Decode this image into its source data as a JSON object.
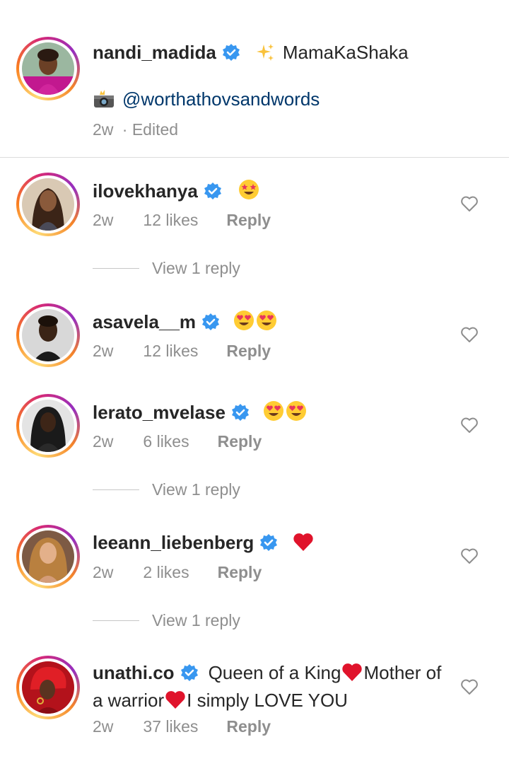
{
  "caption": {
    "username": "nandi_madida",
    "text": "MamaKaShaka",
    "mention": "@worthathovsandwords",
    "time": "2w",
    "edited": "· Edited"
  },
  "comments": [
    {
      "username": "ilovekhanya",
      "text": "",
      "emoji": [
        "star-struck"
      ],
      "time": "2w",
      "likes": "12 likes",
      "reply": "Reply",
      "view_replies": "View 1 reply"
    },
    {
      "username": "asavela__m",
      "text": "",
      "emoji": [
        "heart-eyes",
        "heart-eyes"
      ],
      "time": "2w",
      "likes": "12 likes",
      "reply": "Reply",
      "view_replies": ""
    },
    {
      "username": "lerato_mvelase",
      "text": "",
      "emoji": [
        "heart-eyes",
        "heart-eyes"
      ],
      "time": "2w",
      "likes": "6 likes",
      "reply": "Reply",
      "view_replies": "View 1 reply"
    },
    {
      "username": "leeann_liebenberg",
      "text": "",
      "emoji": [
        "red-heart"
      ],
      "time": "2w",
      "likes": "2 likes",
      "reply": "Reply",
      "view_replies": "View 1 reply"
    },
    {
      "username": "unathi.co",
      "text_part1": "Queen of a King",
      "text_part2": "Mother of a warrior",
      "text_part3": "I simply LOVE YOU",
      "time": "2w",
      "likes": "37 likes",
      "reply": "Reply",
      "view_replies": ""
    }
  ],
  "colors": {
    "verified": "#3897f0",
    "muted": "#8e8e8e",
    "link": "#00376b",
    "heart": "#e0132b"
  }
}
